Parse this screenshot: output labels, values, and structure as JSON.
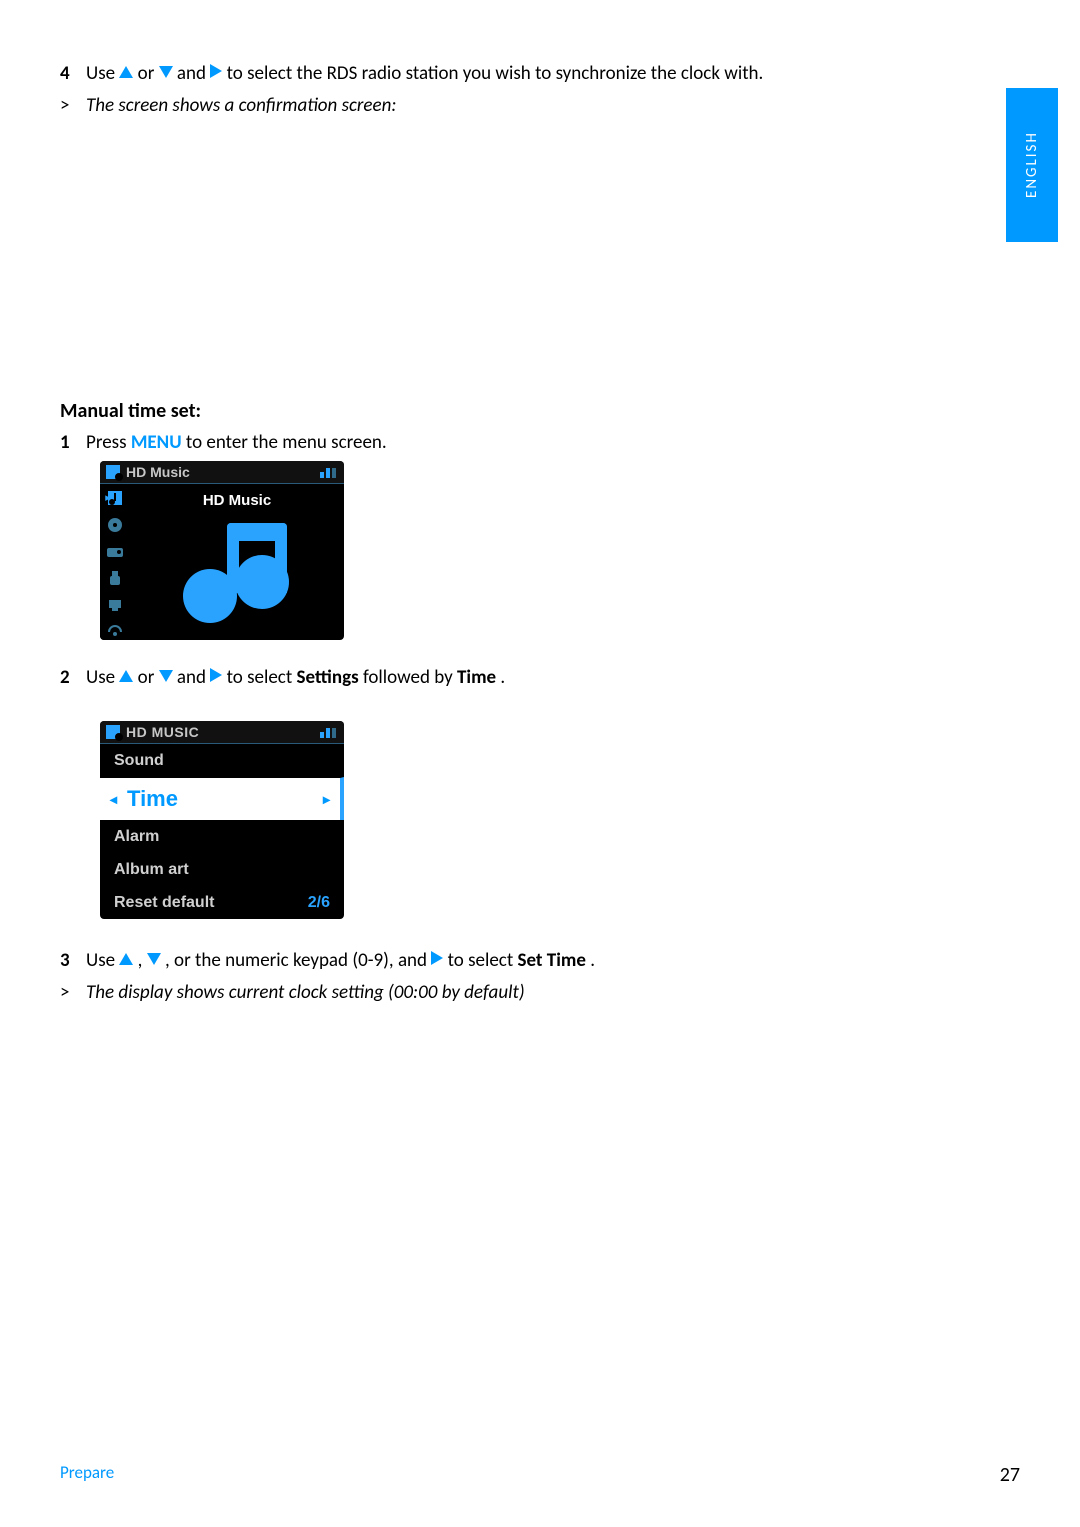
{
  "lang_tab": "ENGLISH",
  "top_steps": {
    "num4": "4",
    "step4_a": "Use ",
    "step4_b": " or ",
    "step4_c": " and ",
    "step4_d": " to select the RDS radio station you wish to synchronize the clock with.",
    "gt": ">",
    "result4": "The screen shows a confirmation screen:"
  },
  "section_heading": "Manual time set:",
  "manual_steps": {
    "num1": "1",
    "step1_a": "Press ",
    "step1_menu": "MENU",
    "step1_b": " to enter the menu screen.",
    "num2": "2",
    "step2_a": "Use ",
    "step2_b": " or ",
    "step2_c": " and ",
    "step2_d": " to select ",
    "step2_settings": "Settings",
    "step2_e": " followed by ",
    "step2_time": "Time",
    "step2_f": ".",
    "num3": "3",
    "step3_a": "Use ",
    "step3_b": ", ",
    "step3_c": ", or the numeric keypad (0-9), and ",
    "step3_d": " to select ",
    "step3_set": "Set Time",
    "step3_e": ".",
    "gt": ">",
    "result3": "The display shows current clock setting (00:00 by default)"
  },
  "screen1": {
    "header": "HD Music",
    "main_title": "HD Music"
  },
  "screen2": {
    "header": "HD MUSIC",
    "items": {
      "sound": "Sound",
      "time": "Time",
      "alarm": "Alarm",
      "album_art": "Album art",
      "reset": "Reset default"
    },
    "page_indicator": "2/6"
  },
  "footer": {
    "section": "Prepare",
    "page": "27"
  }
}
